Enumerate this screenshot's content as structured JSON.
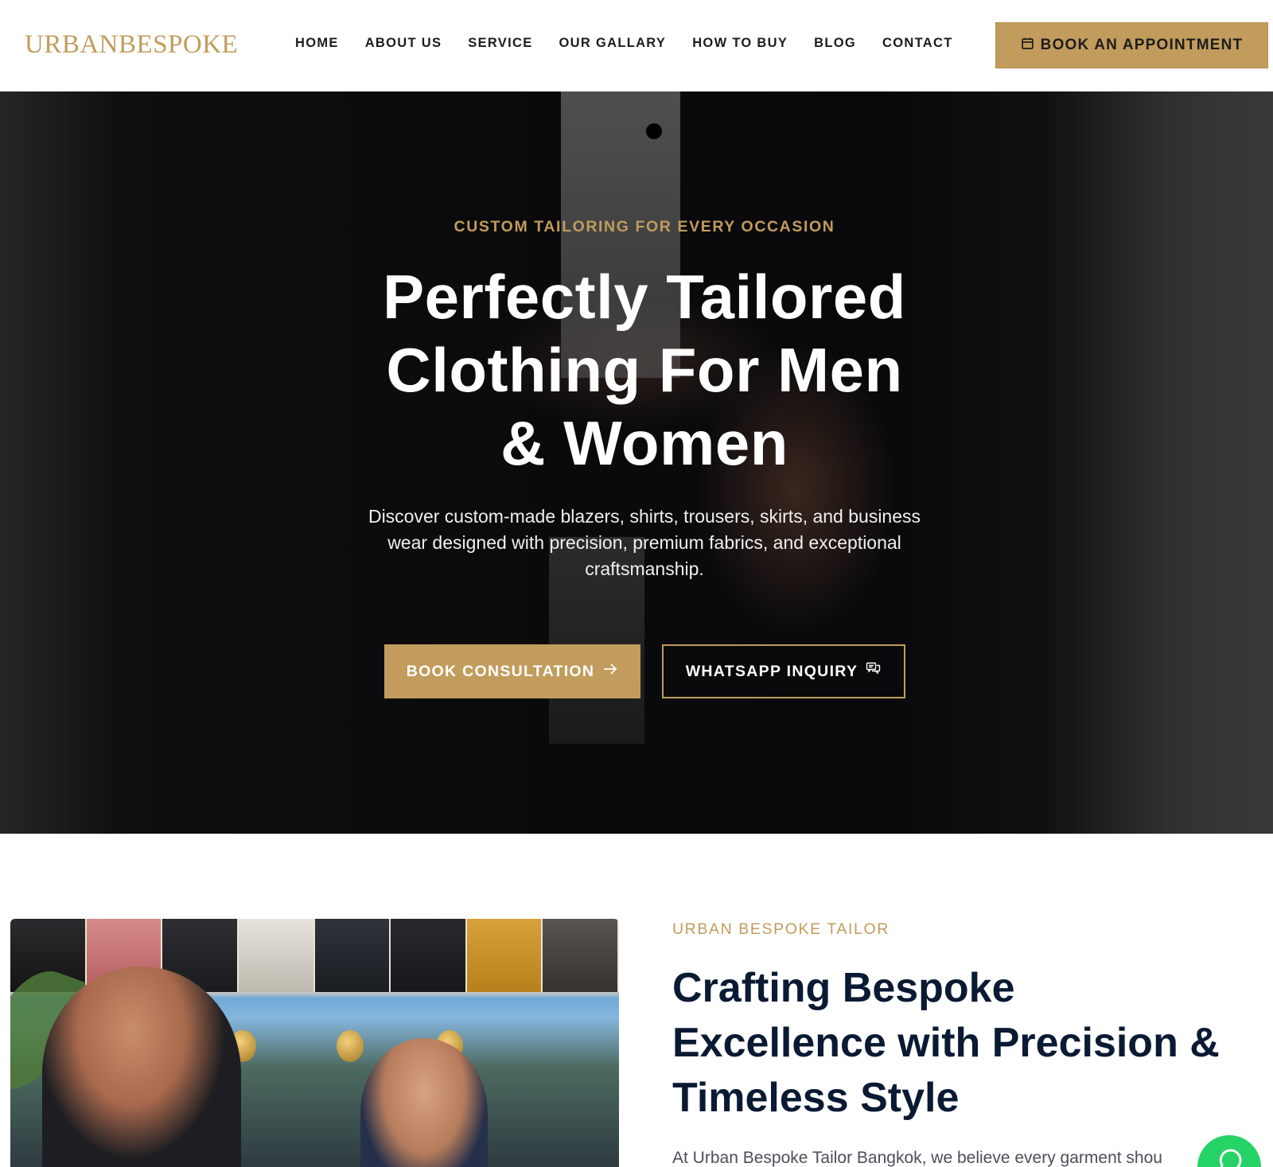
{
  "header": {
    "logo": "URBANBESPOKE",
    "nav": [
      {
        "label": "HOME"
      },
      {
        "label": "ABOUT US"
      },
      {
        "label": "SERVICE"
      },
      {
        "label": "OUR GALLARY"
      },
      {
        "label": "HOW TO BUY"
      },
      {
        "label": "BLOG"
      },
      {
        "label": "CONTACT"
      }
    ],
    "cta_label": "BOOK AN APPOINTMENT",
    "cta_icon": "calendar-icon"
  },
  "hero": {
    "eyebrow": "CUSTOM TAILORING FOR EVERY OCCASION",
    "title_lines": [
      "Perfectly Tailored",
      "Clothing For Men",
      "& Women"
    ],
    "subtitle": "Discover custom-made blazers, shirts, trousers, skirts, and business wear designed with precision, premium fabrics, and exceptional craftsmanship.",
    "primary_button": {
      "label": "BOOK CONSULTATION",
      "icon": "arrow-right-icon"
    },
    "secondary_button": {
      "label": "WHATSAPP INQUIRY",
      "icon": "chat-icon"
    }
  },
  "about": {
    "eyebrow": "URBAN BESPOKE TAILOR",
    "title_lines": [
      "Crafting Bespoke",
      "Excellence with Precision &",
      "Timeless Style"
    ],
    "text": "At Urban Bespoke Tailor Bangkok, we believe every garment shou"
  },
  "floating": {
    "whatsapp_icon": "whatsapp-icon"
  },
  "colors": {
    "accent": "#c29c5c",
    "heading": "#0b1a33",
    "whatsapp": "#25d366"
  }
}
